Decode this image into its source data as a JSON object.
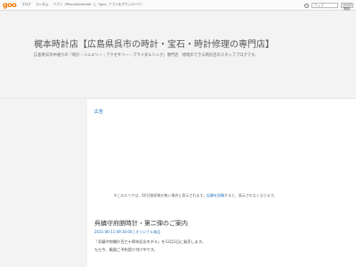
{
  "topbar": {
    "logo": "goo",
    "nav": [
      "ブログ",
      "ランダム"
    ],
    "promo": "アプリ（iPhone/Android）に「goo」アプリをダウンロード！",
    "search_icon": "search-icon",
    "search_value": "ウェブ",
    "search_button": "ブログ開設"
  },
  "header": {
    "title": "梶本時計店【広島県呉市の時計・宝石・時計修理の専門店】",
    "description": "広島県呉市中通りの「時計・ジュエリー・アクセサリー・ブライダルリング」専門店　修理のできる時計店のスタッフブログです。"
  },
  "main": {
    "ad_label": "広告",
    "ad_note_prefix": "※このエリアは、60日間投稿が無い場合に表示されます。",
    "ad_note_link": "記事を投稿",
    "ad_note_suffix": "すると、表示されなくなります。",
    "post": {
      "title": "呉鎮守府腕時計・第二弾のご案内",
      "meta": "2021-06-11 09:30:00 | オリジナル商品",
      "line1": "「呉鎮守府開庁百三十周年記念モデル」を12月1日に発売します。",
      "line2": "ただ今、範囲ご予約受け付け中です。"
    }
  }
}
